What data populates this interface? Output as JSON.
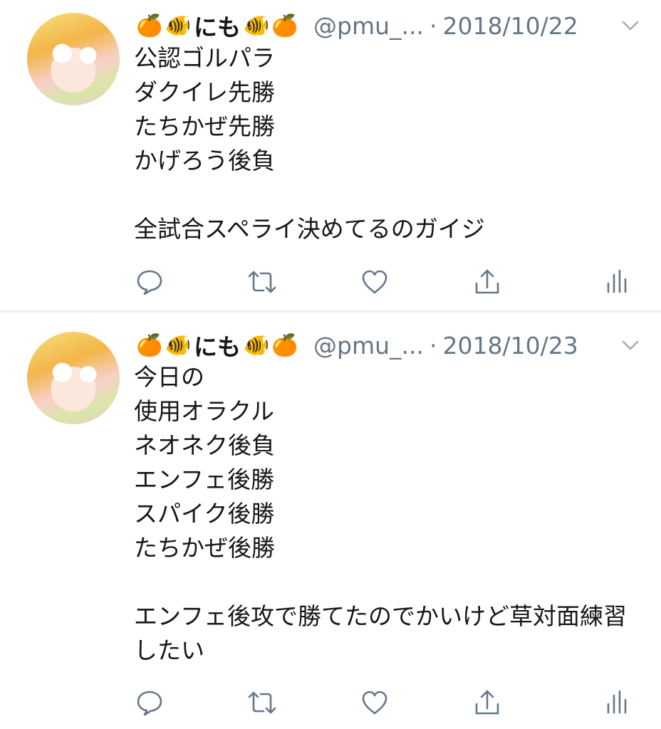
{
  "tweets": [
    {
      "display_name": "にも",
      "name_emojis": {
        "left": [
          "🍊",
          "🐠"
        ],
        "right": [
          "🐠",
          "🍊"
        ]
      },
      "handle": "@pmu_...",
      "separator": "·",
      "date": "2018/10/22",
      "lines": [
        "公認ゴルパラ",
        "ダクイレ先勝",
        "たちかぜ先勝",
        "かげろう後負",
        "",
        "全試合スペライ決めてるのガイジ"
      ]
    },
    {
      "display_name": "にも",
      "name_emojis": {
        "left": [
          "🍊",
          "🐠"
        ],
        "right": [
          "🐠",
          "🍊"
        ]
      },
      "handle": "@pmu_...",
      "separator": "·",
      "date": "2018/10/23",
      "lines": [
        "今日の",
        "使用オラクル",
        "ネオネク後負",
        "エンフェ後勝",
        "スパイク後勝",
        "たちかぜ後勝",
        "",
        "エンフェ後攻で勝てたのでかいけど草対面練習したい"
      ]
    }
  ],
  "icons": {
    "reply": "reply-icon",
    "retweet": "retweet-icon",
    "like": "heart-icon",
    "share": "share-icon",
    "analytics": "analytics-icon",
    "caret": "chevron-down-icon"
  },
  "colors": {
    "text": "#14171a",
    "secondary": "#657786",
    "divider": "#e6ecf0",
    "orange_emoji": "#f28b1e",
    "fish_emoji": "#2aa7c4"
  }
}
